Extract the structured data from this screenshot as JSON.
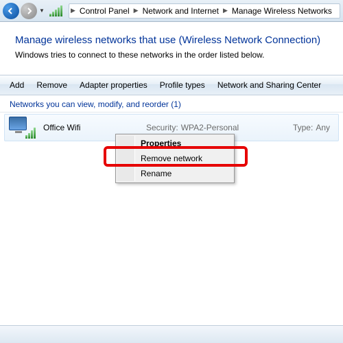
{
  "breadcrumb": {
    "items": [
      "Control Panel",
      "Network and Internet",
      "Manage Wireless Networks"
    ]
  },
  "page": {
    "title": "Manage wireless networks that use (Wireless Network Connection)",
    "desc": "Windows tries to connect to these networks in the order listed below."
  },
  "cmdbar": {
    "add": "Add",
    "remove": "Remove",
    "adapter": "Adapter properties",
    "profiles": "Profile types",
    "nsc": "Network and Sharing Center"
  },
  "group": {
    "header": "Networks you can view, modify, and reorder (1)"
  },
  "network": {
    "name": "Office Wifi",
    "sec_label": "Security:",
    "sec_value": "WPA2-Personal",
    "type_label": "Type:",
    "type_value": "Any"
  },
  "context_menu": {
    "properties": "Properties",
    "remove": "Remove network",
    "rename": "Rename"
  }
}
